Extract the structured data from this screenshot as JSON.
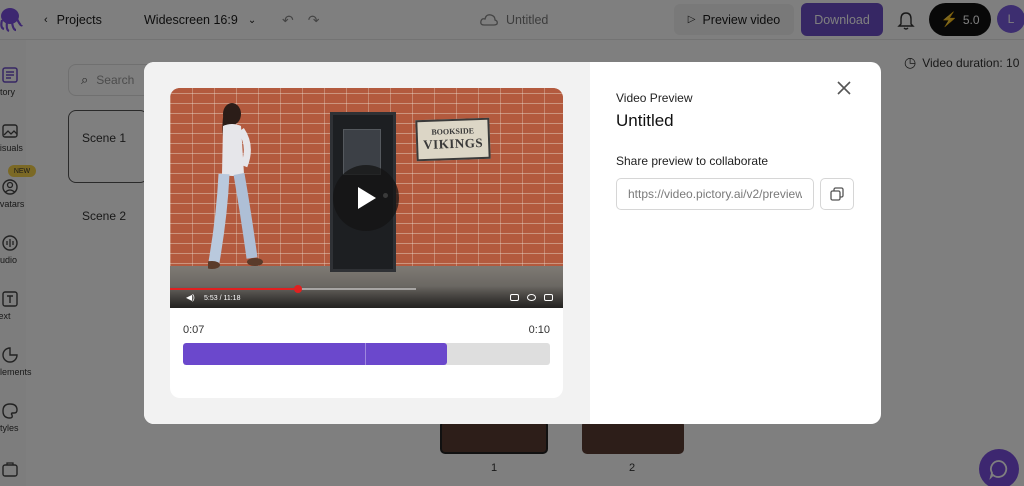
{
  "topbar": {
    "back_label": "Projects",
    "aspect_label": "Widescreen 16:9",
    "doc_title": "Untitled",
    "preview_label": "Preview video",
    "download_label": "Download",
    "credits": "5.0",
    "avatar_initial": "L"
  },
  "sidebar": {
    "items": [
      {
        "label": "Story",
        "icon": "story-icon"
      },
      {
        "label": "Visuals",
        "icon": "image-icon"
      },
      {
        "label": "Avatars",
        "icon": "avatar-icon",
        "badge": "NEW"
      },
      {
        "label": "Audio",
        "icon": "audio-icon"
      },
      {
        "label": "Text",
        "icon": "text-icon"
      },
      {
        "label": "Elements",
        "icon": "elements-icon"
      },
      {
        "label": "Styles",
        "icon": "palette-icon"
      }
    ]
  },
  "story": {
    "search_placeholder": "Search",
    "scenes": [
      "Scene 1",
      "Scene 2"
    ],
    "duration_label": "Video duration: 10"
  },
  "timeline": {
    "thumbs": [
      "1",
      "2"
    ]
  },
  "modal": {
    "label": "Video Preview",
    "title": "Untitled",
    "share_label": "Share preview to collaborate",
    "share_url": "https://video.pictory.ai/v2/preview",
    "video": {
      "sign_top": "BOOKSIDE",
      "sign_main": "VIKINGS",
      "player_time": "5:53 / 11:18",
      "player_progress": 0.52
    },
    "trim": {
      "start_label": "0:07",
      "end_label": "0:10",
      "fill_fraction": 0.72,
      "marker_fraction": 0.495
    }
  },
  "colors": {
    "accent": "#6d4fc9",
    "trim_fill": "#6b48cc",
    "youtube_red": "#e02020"
  }
}
